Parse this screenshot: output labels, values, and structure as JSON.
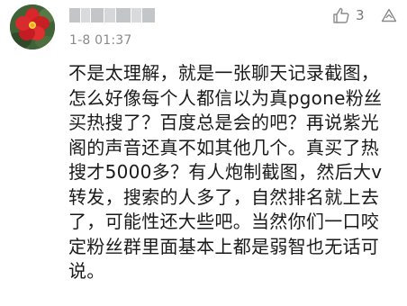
{
  "comment": {
    "timestamp": "1-8 01:37",
    "like_count": "3",
    "icons": {
      "like": "thumbs-up-icon",
      "more": "more-triangle-icon"
    },
    "body_lines": [
      "不是太理解，就是一张聊天记录截图，",
      "怎么好像每个人都信以为真pgone粉丝",
      "买热搜了？百度总是会的吧？再说紫光",
      "阁的声音还真不如其他几个。真买了热",
      "搜才5000多？有人炮制截图，然后大v",
      "转发，搜索的人多了，自然排名就上去",
      "了，可能性还大些吧。当然你们一口咬",
      "定粉丝群里面基本上都是弱智也无话可",
      "说。"
    ]
  }
}
